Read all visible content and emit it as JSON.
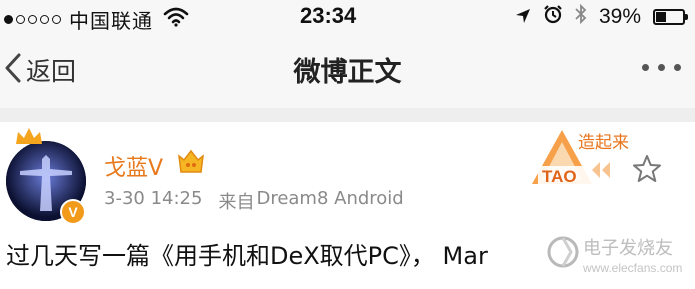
{
  "status_bar": {
    "carrier": "中国联通",
    "time": "23:34",
    "battery": "39%",
    "battery_level": 0.39,
    "signal_dots": [
      true,
      false,
      false,
      false,
      false
    ]
  },
  "nav": {
    "back_label": "返回",
    "title": "微博正文"
  },
  "post": {
    "username": "戈蓝V",
    "timestamp": "3-30 14:25",
    "source_prefix": "来自",
    "source": "Dream8 Android",
    "text": "过几天写一篇《用手机和DeX取代PC》， Mar",
    "avatar_badge": "V",
    "promo_badge": "造起来",
    "promo_logo": "TAO"
  },
  "watermark": {
    "text": "电子发烧友",
    "url": "www.elecfans.com"
  },
  "icons": [
    "wifi-icon",
    "location-arrow-icon",
    "alarm-icon",
    "bluetooth-icon",
    "battery-icon",
    "chevron-left-icon",
    "more-dots-icon",
    "crown-icon",
    "vip-badge-icon",
    "star-icon"
  ]
}
